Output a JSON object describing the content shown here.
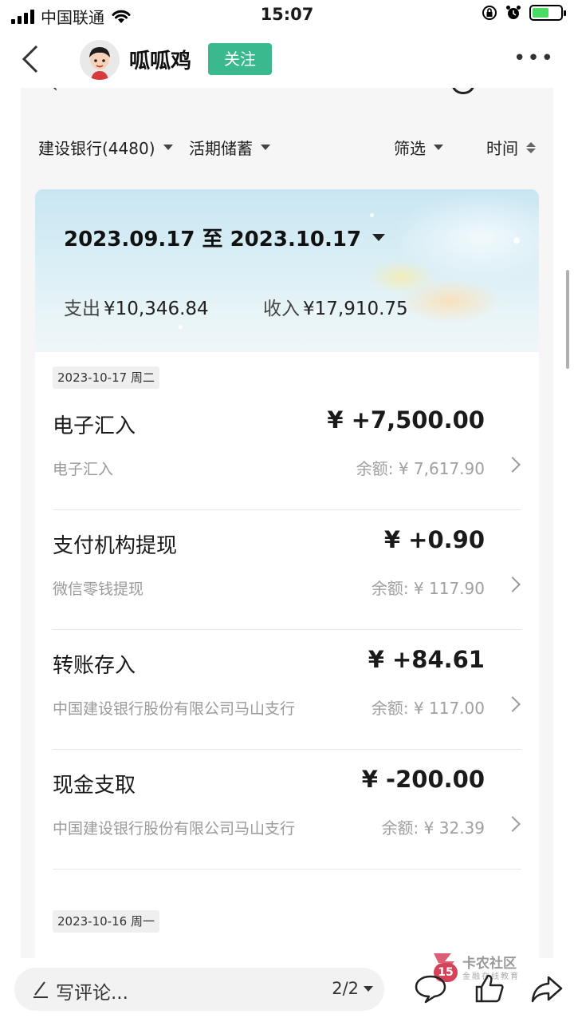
{
  "status_bar": {
    "carrier": "中国联通",
    "time": "15:07"
  },
  "header": {
    "username": "呱呱鸡",
    "follow_label": "关注"
  },
  "filters": {
    "account": "建设银行(4480)",
    "type": "活期储蓄",
    "filter": "筛选",
    "sort": "时间"
  },
  "banner": {
    "date_range": "2023.09.17 至 2023.10.17",
    "expense_label": "支出",
    "expense_value": "¥10,346.84",
    "income_label": "收入",
    "income_value": "¥17,910.75"
  },
  "groups": [
    {
      "date": "2023-10-17 周二",
      "transactions": [
        {
          "title": "电子汇入",
          "amount": "¥ +7,500.00",
          "sub": "电子汇入",
          "balance": "余额: ¥ 7,617.90"
        },
        {
          "title": "支付机构提现",
          "amount": "¥ +0.90",
          "sub": "微信零钱提现",
          "balance": "余额: ¥ 117.90"
        },
        {
          "title": "转账存入",
          "amount": "¥ +84.61",
          "sub": "中国建设银行股份有限公司马山支行",
          "balance": "余额: ¥ 117.00"
        },
        {
          "title": "现金支取",
          "amount": "¥ -200.00",
          "sub": "中国建设银行股份有限公司马山支行",
          "balance": "余额: ¥ 32.39"
        }
      ]
    },
    {
      "date": "2023-10-16 周一",
      "transactions": []
    }
  ],
  "watermark": {
    "badge": "15",
    "title": "卡农社区",
    "subtitle": "金融在线教育"
  },
  "bottom_bar": {
    "comment_placeholder": "写评论...",
    "page_indicator": "2/2"
  },
  "icons": [
    "signal-icon",
    "wifi-icon",
    "lock-rotation-icon",
    "alarm-icon",
    "battery-icon",
    "back-icon",
    "more-icon",
    "pen-icon",
    "comment-icon",
    "like-icon",
    "share-icon"
  ],
  "colors": {
    "accent": "#3bb98e",
    "badge": "#d6425a"
  }
}
